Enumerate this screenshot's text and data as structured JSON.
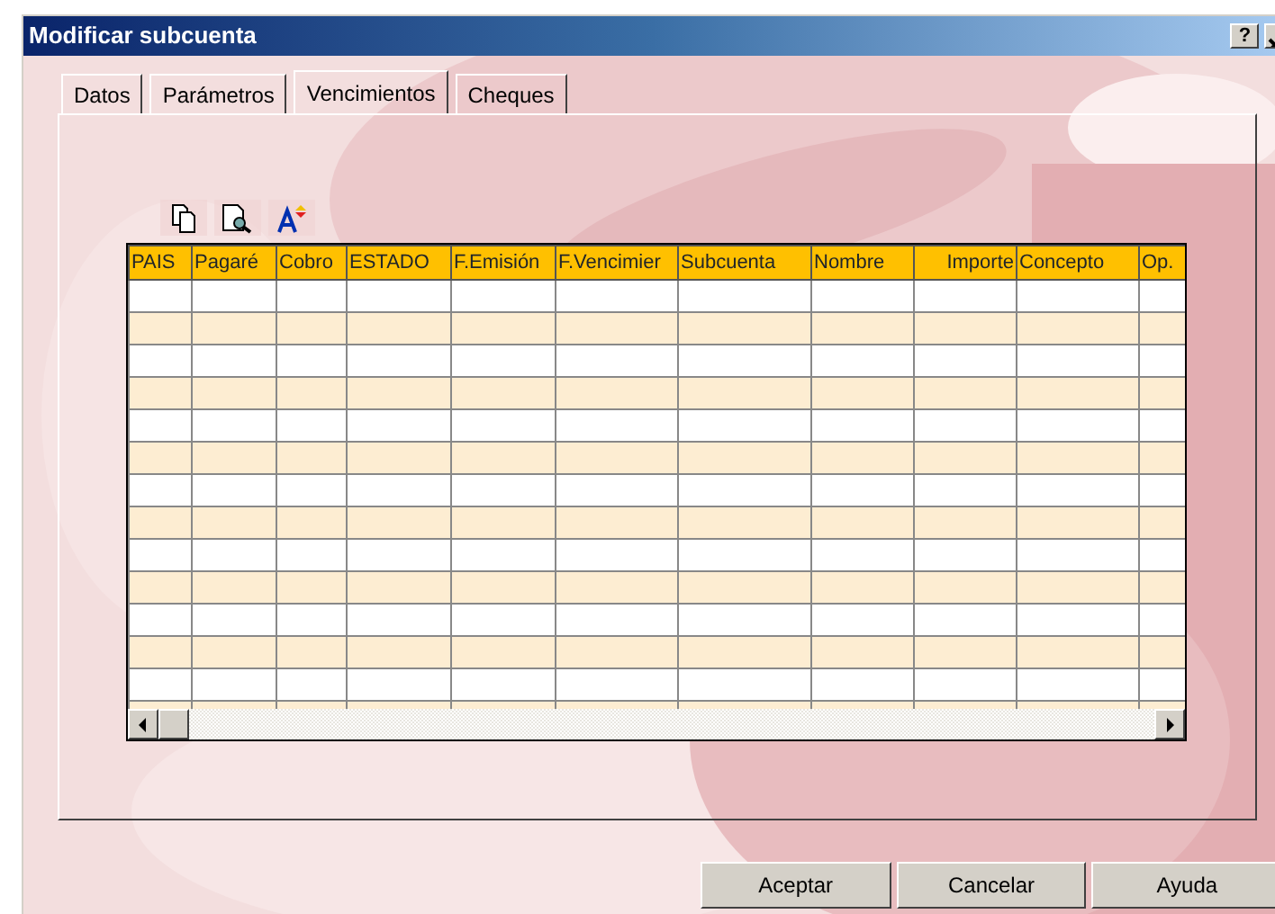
{
  "window": {
    "title": "Modificar subcuenta",
    "help_button": "?"
  },
  "background": {
    "kind": "picture"
  },
  "tabs": [
    {
      "label": "Datos",
      "selected": false
    },
    {
      "label": "Parámetros",
      "selected": false
    },
    {
      "label": "Vencimientos",
      "selected": true
    },
    {
      "label": "Cheques",
      "selected": false
    }
  ],
  "toolbar": [
    {
      "kind": "page"
    },
    {
      "kind": "preview"
    },
    {
      "kind": "font"
    }
  ],
  "table": {
    "columns": [
      {
        "label": "PAIS",
        "kind": "left"
      },
      {
        "label": "Pagaré",
        "kind": "left"
      },
      {
        "label": "Cobro",
        "kind": "left"
      },
      {
        "label": "ESTADO",
        "kind": "left"
      },
      {
        "label": "F.Emisión",
        "kind": "left"
      },
      {
        "label": "F.Vencimier",
        "kind": "left"
      },
      {
        "label": "Subcuenta",
        "kind": "left"
      },
      {
        "label": "Nombre",
        "kind": "left"
      },
      {
        "label": "Importe",
        "kind": "right"
      },
      {
        "label": "Concepto",
        "kind": "left"
      },
      {
        "label": "Op.",
        "kind": "left"
      }
    ],
    "rows": [
      {
        "shaded": false
      },
      {
        "shaded": true
      },
      {
        "shaded": false
      },
      {
        "shaded": true
      },
      {
        "shaded": false
      },
      {
        "shaded": true
      },
      {
        "shaded": false
      },
      {
        "shaded": true
      },
      {
        "shaded": false
      },
      {
        "shaded": true
      },
      {
        "shaded": false
      },
      {
        "shaded": true
      },
      {
        "shaded": false
      },
      {
        "shaded": true
      }
    ]
  },
  "buttons": [
    "Aceptar",
    "Cancelar",
    "Ayuda"
  ]
}
